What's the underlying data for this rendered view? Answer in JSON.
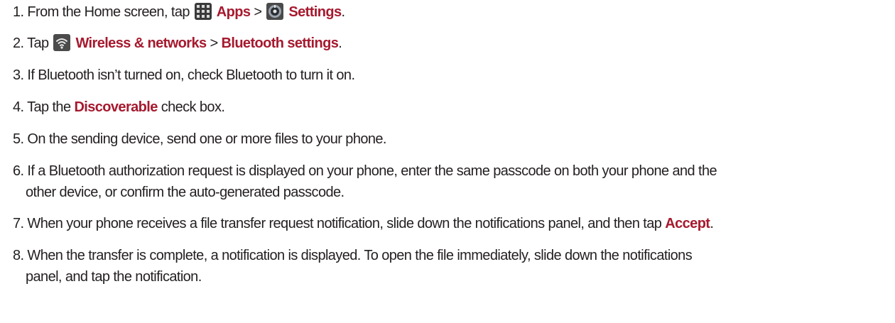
{
  "steps": [
    {
      "lead": "1. From the Home screen, tap ",
      "icon1": "apps-icon",
      "kw1": "Apps",
      "sep": " > ",
      "icon2": "settings-icon",
      "kw2": "Settings",
      "tail": "."
    },
    {
      "lead": "2. Tap ",
      "icon1": "wifi-icon",
      "kw1": "Wireless & networks",
      "sep": " > ",
      "kw2": "Bluetooth settings",
      "tail": "."
    },
    {
      "text": "3. If Bluetooth isn’t turned on, check Bluetooth to turn it on."
    },
    {
      "lead": "4. Tap the ",
      "kw1": "Discoverable",
      "tail": " check box."
    },
    {
      "text": "5. On the sending device, send one or more files to your phone."
    },
    {
      "line1": "6. If a Bluetooth authorization request is displayed on your phone, enter the same passcode on both your phone and the",
      "line2": "other device, or confirm the auto-generated passcode."
    },
    {
      "lead": "7. When your phone receives a file transfer request notification, slide down the notifications panel, and then tap ",
      "kw1": "Accept",
      "tail": "."
    },
    {
      "line1": "8. When the transfer is complete, a notification is displayed. To open the file immediately, slide down the notifications",
      "line2": "panel, and tap the notification."
    }
  ],
  "colors": {
    "text": "#231f20",
    "keyword": "#a6192e"
  }
}
